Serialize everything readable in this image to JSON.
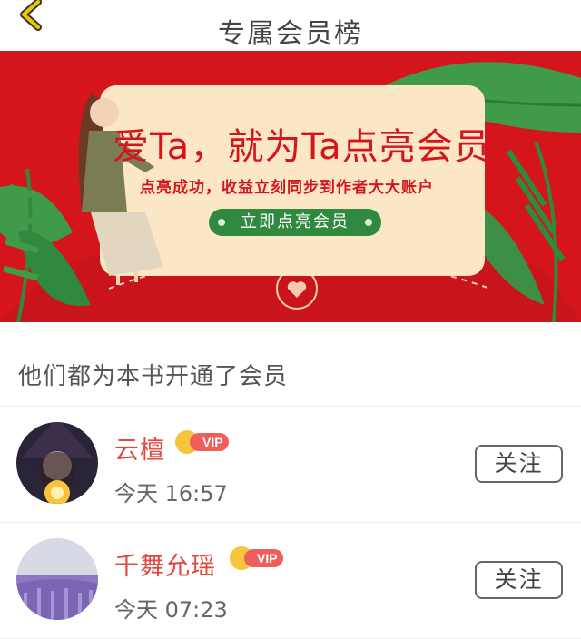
{
  "header": {
    "title": "专属会员榜",
    "back_icon": "chevron-left-icon",
    "back_icon_color": "#f2c400"
  },
  "banner": {
    "headline": "爱Ta，就为Ta点亮会员",
    "subtitle": "点亮成功，收益立刻同步到作者大大账户",
    "button_label": "立即点亮会员",
    "background_color": "#d4161c",
    "button_color": "#2f8a3f"
  },
  "section": {
    "title": "他们都为本书开通了会员"
  },
  "members": [
    {
      "name": "云檀",
      "badge": "VIP",
      "time": "今天 16:57",
      "follow_label": "关注",
      "avatar_icon": "witch-avatar"
    },
    {
      "name": "千舞允瑶",
      "badge": "VIP",
      "time": "今天 07:23",
      "follow_label": "关注",
      "avatar_icon": "lavender-field-avatar"
    }
  ],
  "colors": {
    "name_color": "#e0493f",
    "vip_badge": "#ef5d5d",
    "crown": "#f6c53b"
  }
}
